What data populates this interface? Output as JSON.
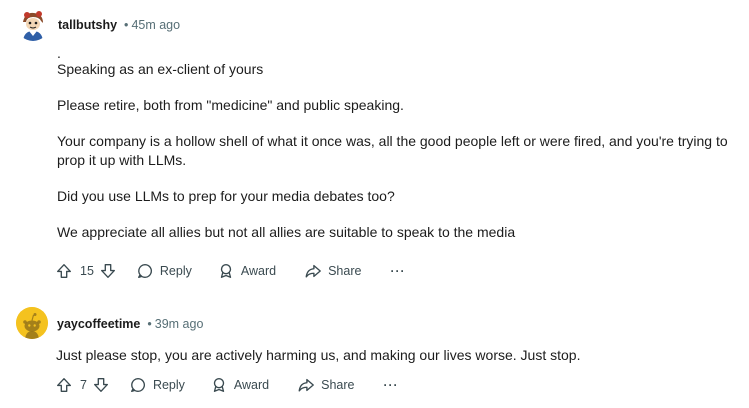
{
  "comments": [
    {
      "username": "tallbutshy",
      "separator": "•",
      "time": "45m ago",
      "lines": [
        ".",
        "Speaking as an ex-client of yours",
        "Please retire, both from \"medicine\" and public speaking.",
        "Your company is a hollow shell of what it once was, all the good people left or were fired, and you're trying to prop it up with LLMs.",
        "Did you use LLMs to prep for your media debates too?",
        "We appreciate all allies but not all allies are suitable to speak to the media"
      ],
      "votes": "15",
      "reply_label": "Reply",
      "award_label": "Award",
      "share_label": "Share",
      "more_label": "···"
    },
    {
      "username": "yaycoffeetime",
      "separator": "•",
      "time": "39m ago",
      "lines": [
        "Just please stop, you are actively harming us, and making our lives worse. Just stop."
      ],
      "votes": "7",
      "reply_label": "Reply",
      "award_label": "Award",
      "share_label": "Share",
      "more_label": "···"
    }
  ],
  "colors": {
    "text": "#1c1c1c",
    "meta": "#576f76",
    "action": "#3a4a50",
    "avatar2_bg": "#f4c21f"
  },
  "icons": [
    "avatar-illustration",
    "snoo-avatar",
    "upvote-icon",
    "downvote-icon",
    "reply-icon",
    "award-icon",
    "share-icon",
    "more-icon"
  ]
}
